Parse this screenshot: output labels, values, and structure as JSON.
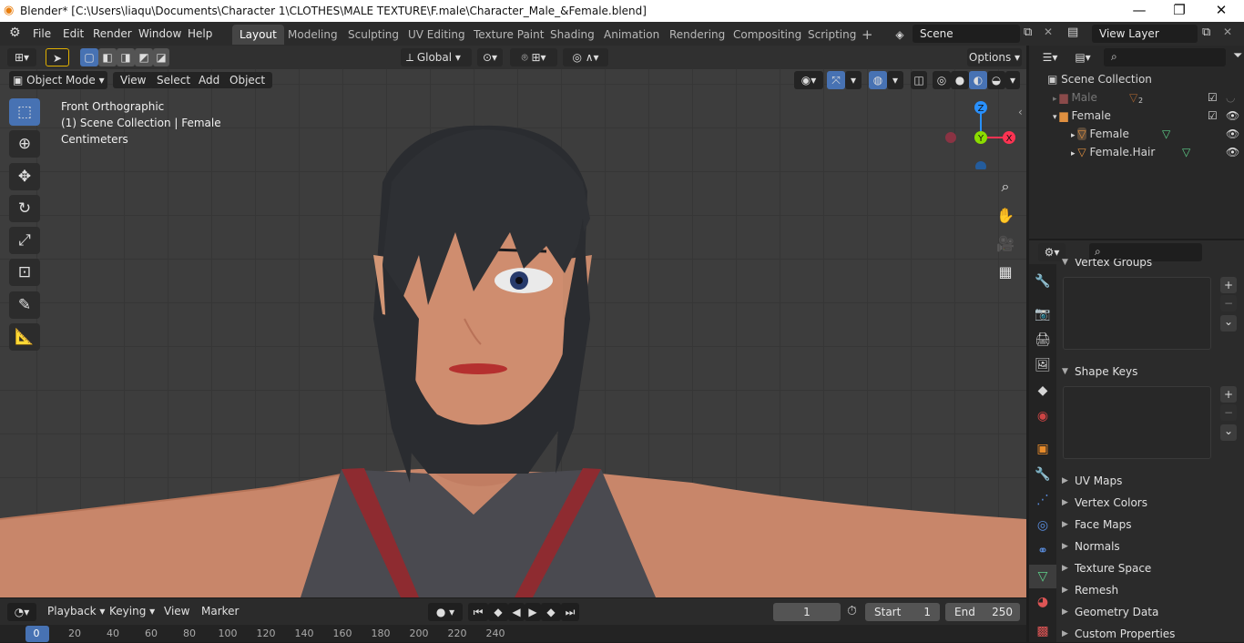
{
  "window": {
    "title": "Blender* [C:\\Users\\liaqu\\Documents\\Character 1\\CLOTHES\\MALE TEXTURE\\F.male\\Character_Male_&Female.blend]",
    "controls": {
      "minimize": "—",
      "maximize": "❐",
      "close": "✕"
    }
  },
  "menu": [
    "File",
    "Edit",
    "Render",
    "Window",
    "Help"
  ],
  "workspaces": [
    "Layout",
    "Modeling",
    "Sculpting",
    "UV Editing",
    "Texture Paint",
    "Shading",
    "Animation",
    "Rendering",
    "Compositing",
    "Scripting"
  ],
  "add_workspace": "+",
  "scene": {
    "label": "Scene"
  },
  "view_layer": {
    "label": "View Layer"
  },
  "viewport": {
    "transform_orientation": "Global",
    "options_label": "Options",
    "mode": "Object Mode",
    "menus": [
      "View",
      "Select",
      "Add",
      "Object"
    ],
    "overlay_text": [
      "Front Orthographic",
      "(1) Scene Collection | Female",
      "Centimeters"
    ],
    "gizmo": {
      "z": "Z",
      "y": "Y",
      "x": "X"
    }
  },
  "outliner": {
    "search_placeholder": "",
    "root": "Scene Collection",
    "items": [
      {
        "label": "Male",
        "badge": "2",
        "dim": true
      },
      {
        "label": "Female",
        "dim": false
      },
      {
        "label": "Female",
        "dim": false
      },
      {
        "label": "Female.Hair",
        "dim": false
      }
    ]
  },
  "properties": {
    "panels": [
      "Vertex Groups",
      "Shape Keys",
      "UV Maps",
      "Vertex Colors",
      "Face Maps",
      "Normals",
      "Texture Space",
      "Remesh",
      "Geometry Data",
      "Custom Properties"
    ],
    "plus": "+",
    "minus": "−",
    "chevron": "⌄"
  },
  "timeline": {
    "menus": [
      "Playback",
      "Keying",
      "View",
      "Marker"
    ],
    "current_frame": "1",
    "start_label": "Start",
    "start": "1",
    "end_label": "End",
    "end": "250",
    "ticks": [
      "0",
      "20",
      "40",
      "60",
      "80",
      "100",
      "120",
      "140",
      "160",
      "180",
      "200",
      "220",
      "240"
    ]
  },
  "colors": {
    "accent": "#4772b3",
    "axis_x": "#ff3352",
    "axis_y": "#8bdc00",
    "axis_z": "#2890ff",
    "header": "#303030"
  }
}
